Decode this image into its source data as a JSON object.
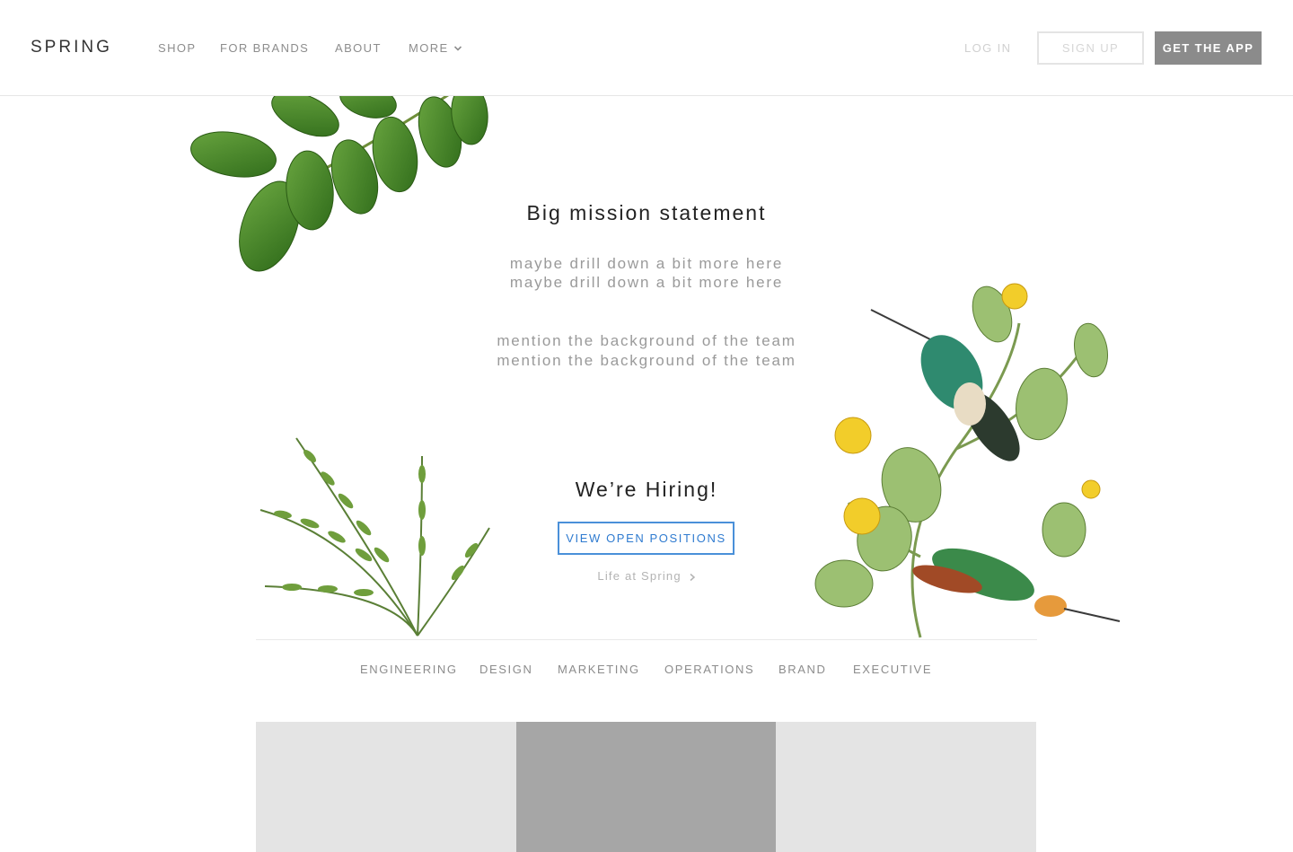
{
  "header": {
    "logo": "SPRING",
    "nav": {
      "shop": "SHOP",
      "for_brands": "FOR BRANDS",
      "about": "ABOUT",
      "more": "MORE"
    },
    "login": "LOG IN",
    "signup": "SIGN UP",
    "get_app": "GET THE APP"
  },
  "hero": {
    "mission": "Big mission statement",
    "sub1_line1": "maybe drill down a bit more here",
    "sub1_line2": "maybe drill down a bit more here",
    "sub2_line1": "mention the background of the team",
    "sub2_line2": "mention the background of the team"
  },
  "hiring": {
    "title": "We’re Hiring!",
    "button": "VIEW OPEN POSITIONS",
    "life_link": "Life at Spring"
  },
  "departments": [
    "ENGINEERING",
    "DESIGN",
    "MARKETING",
    "OPERATIONS",
    "BRAND",
    "EXECUTIVE"
  ],
  "colors": {
    "accent_blue": "#4a90d9",
    "app_button": "#8b8b8b",
    "leaf_green": "#4f8a2b",
    "tile_light": "#e4e4e4",
    "tile_dark": "#a6a6a6"
  },
  "icons": {
    "more_chevron": "chevron-down-icon",
    "life_chevron": "chevron-right-icon"
  }
}
